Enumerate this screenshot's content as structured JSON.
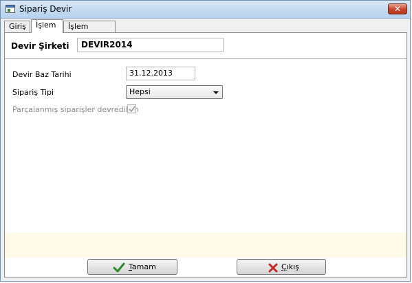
{
  "window": {
    "title": "Sipariş Devir",
    "close_label": "✕"
  },
  "tabs": [
    {
      "label": "Giriş",
      "active": false
    },
    {
      "label": "İşlem",
      "active": true
    },
    {
      "label": "İşlem Sonucu",
      "active": false
    }
  ],
  "header": {
    "company_label": "Devir Şirketi",
    "company_value": "DEVIR2014"
  },
  "form": {
    "base_date_label": "Devir Baz Tarihi",
    "base_date_value": "31.12.2013",
    "order_type_label": "Sipariş Tipi",
    "order_type_value": "Hepsi",
    "split_orders_label": "Parçalanmış siparişler devredilsin",
    "split_orders_checked": true
  },
  "buttons": {
    "ok": {
      "first": "T",
      "rest": "amam",
      "icon": "checkmark-icon",
      "icon_color": "#2e8b2e"
    },
    "cancel": {
      "first": "Ç",
      "rest": "ıkış",
      "icon": "x-icon",
      "icon_color": "#c0281e"
    }
  }
}
